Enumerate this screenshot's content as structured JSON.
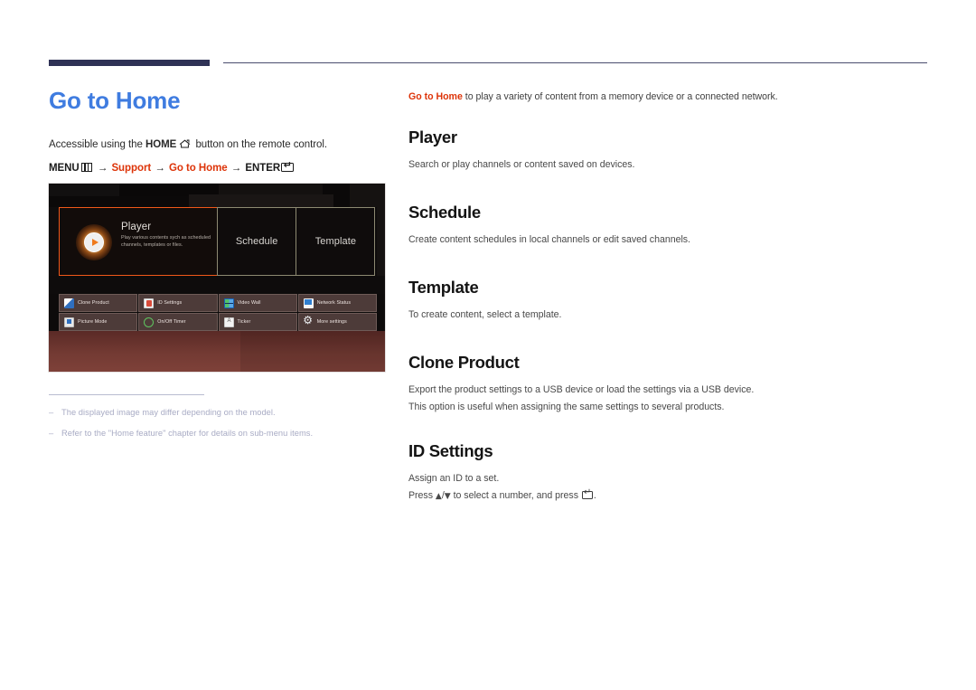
{
  "document": {
    "page_title": "Go to Home",
    "accent_blue": "#3f7ce0",
    "accent_red": "#dd3409",
    "rule_navy": "#2f3256"
  },
  "left": {
    "intro_prefix": "Accessible using the ",
    "intro_home_bold": "HOME",
    "intro_suffix": " button on the remote control.",
    "menu_path": {
      "menu_label": "MENU",
      "arrow": "→",
      "step1": "Support",
      "step2": "Go to Home",
      "enter_label": "ENTER"
    }
  },
  "tv_screen": {
    "tiles": [
      {
        "label": "Player",
        "description": "Play various contents sych as scheduled channels, templates or files.",
        "selected": true,
        "icon": "play-circle-icon"
      },
      {
        "label": "Schedule",
        "description": "",
        "selected": false,
        "icon": ""
      },
      {
        "label": "Template",
        "description": "",
        "selected": false,
        "icon": ""
      }
    ],
    "subtiles": [
      {
        "label": "Clone Product",
        "icon": "clone-product-icon"
      },
      {
        "label": "ID Settings",
        "icon": "id-settings-icon"
      },
      {
        "label": "Video Wall",
        "icon": "video-wall-icon"
      },
      {
        "label": "Network Status",
        "icon": "network-status-icon"
      },
      {
        "label": "Picture Mode",
        "icon": "picture-mode-icon"
      },
      {
        "label": "On/Off Timer",
        "icon": "on-off-timer-icon"
      },
      {
        "label": "Ticker",
        "icon": "ticker-icon"
      },
      {
        "label": "More settings",
        "icon": "gear-icon"
      }
    ]
  },
  "notes": [
    {
      "dash": "–",
      "text": "The displayed image may differ depending on the model."
    },
    {
      "dash": "–",
      "text": "Refer to the \"Home feature\" chapter for details on sub-menu items."
    }
  ],
  "right": {
    "lead_link": "Go to Home",
    "lead_rest": " to play a variety of content from a memory device or a connected network.",
    "sections": [
      {
        "heading": "Player",
        "body": [
          "Search or play channels or content saved on devices."
        ]
      },
      {
        "heading": "Schedule",
        "body": [
          "Create content schedules in local channels or edit saved channels."
        ]
      },
      {
        "heading": "Template",
        "body": [
          "To create content, select a template."
        ]
      },
      {
        "heading": "Clone Product",
        "body": [
          "Export the product settings to a USB device or load the settings via a USB device.",
          "This option is useful when assigning the same settings to several products."
        ]
      },
      {
        "heading": "ID Settings",
        "body": [
          "Assign an ID to a set."
        ],
        "press_line": {
          "prefix": "Press ",
          "up": "▲",
          "slash": "/",
          "down": "▼",
          "mid": " to select a number, and press ",
          "suffix": "."
        }
      }
    ]
  }
}
